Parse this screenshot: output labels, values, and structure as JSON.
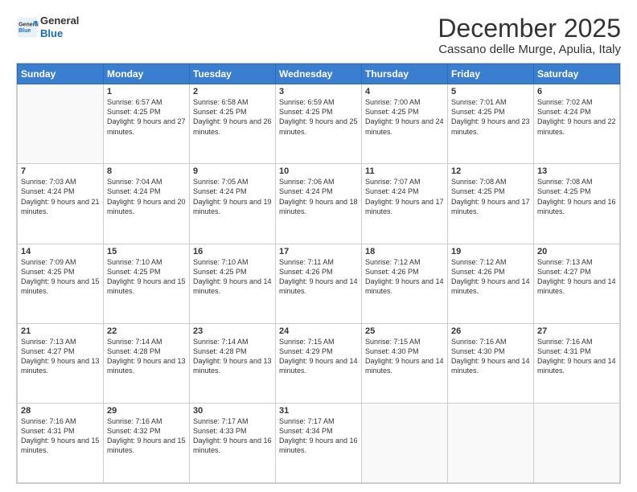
{
  "header": {
    "logo_line1": "General",
    "logo_line2": "Blue",
    "month": "December 2025",
    "location": "Cassano delle Murge, Apulia, Italy"
  },
  "weekdays": [
    "Sunday",
    "Monday",
    "Tuesday",
    "Wednesday",
    "Thursday",
    "Friday",
    "Saturday"
  ],
  "weeks": [
    [
      {
        "day": "",
        "sunrise": "",
        "sunset": "",
        "daylight": ""
      },
      {
        "day": "1",
        "sunrise": "6:57 AM",
        "sunset": "4:25 PM",
        "daylight": "9 hours and 27 minutes."
      },
      {
        "day": "2",
        "sunrise": "6:58 AM",
        "sunset": "4:25 PM",
        "daylight": "9 hours and 26 minutes."
      },
      {
        "day": "3",
        "sunrise": "6:59 AM",
        "sunset": "4:25 PM",
        "daylight": "9 hours and 25 minutes."
      },
      {
        "day": "4",
        "sunrise": "7:00 AM",
        "sunset": "4:25 PM",
        "daylight": "9 hours and 24 minutes."
      },
      {
        "day": "5",
        "sunrise": "7:01 AM",
        "sunset": "4:25 PM",
        "daylight": "9 hours and 23 minutes."
      },
      {
        "day": "6",
        "sunrise": "7:02 AM",
        "sunset": "4:24 PM",
        "daylight": "9 hours and 22 minutes."
      }
    ],
    [
      {
        "day": "7",
        "sunrise": "7:03 AM",
        "sunset": "4:24 PM",
        "daylight": "9 hours and 21 minutes."
      },
      {
        "day": "8",
        "sunrise": "7:04 AM",
        "sunset": "4:24 PM",
        "daylight": "9 hours and 20 minutes."
      },
      {
        "day": "9",
        "sunrise": "7:05 AM",
        "sunset": "4:24 PM",
        "daylight": "9 hours and 19 minutes."
      },
      {
        "day": "10",
        "sunrise": "7:06 AM",
        "sunset": "4:24 PM",
        "daylight": "9 hours and 18 minutes."
      },
      {
        "day": "11",
        "sunrise": "7:07 AM",
        "sunset": "4:24 PM",
        "daylight": "9 hours and 17 minutes."
      },
      {
        "day": "12",
        "sunrise": "7:08 AM",
        "sunset": "4:25 PM",
        "daylight": "9 hours and 17 minutes."
      },
      {
        "day": "13",
        "sunrise": "7:08 AM",
        "sunset": "4:25 PM",
        "daylight": "9 hours and 16 minutes."
      }
    ],
    [
      {
        "day": "14",
        "sunrise": "7:09 AM",
        "sunset": "4:25 PM",
        "daylight": "9 hours and 15 minutes."
      },
      {
        "day": "15",
        "sunrise": "7:10 AM",
        "sunset": "4:25 PM",
        "daylight": "9 hours and 15 minutes."
      },
      {
        "day": "16",
        "sunrise": "7:10 AM",
        "sunset": "4:25 PM",
        "daylight": "9 hours and 14 minutes."
      },
      {
        "day": "17",
        "sunrise": "7:11 AM",
        "sunset": "4:26 PM",
        "daylight": "9 hours and 14 minutes."
      },
      {
        "day": "18",
        "sunrise": "7:12 AM",
        "sunset": "4:26 PM",
        "daylight": "9 hours and 14 minutes."
      },
      {
        "day": "19",
        "sunrise": "7:12 AM",
        "sunset": "4:26 PM",
        "daylight": "9 hours and 14 minutes."
      },
      {
        "day": "20",
        "sunrise": "7:13 AM",
        "sunset": "4:27 PM",
        "daylight": "9 hours and 14 minutes."
      }
    ],
    [
      {
        "day": "21",
        "sunrise": "7:13 AM",
        "sunset": "4:27 PM",
        "daylight": "9 hours and 13 minutes."
      },
      {
        "day": "22",
        "sunrise": "7:14 AM",
        "sunset": "4:28 PM",
        "daylight": "9 hours and 13 minutes."
      },
      {
        "day": "23",
        "sunrise": "7:14 AM",
        "sunset": "4:28 PM",
        "daylight": "9 hours and 13 minutes."
      },
      {
        "day": "24",
        "sunrise": "7:15 AM",
        "sunset": "4:29 PM",
        "daylight": "9 hours and 14 minutes."
      },
      {
        "day": "25",
        "sunrise": "7:15 AM",
        "sunset": "4:30 PM",
        "daylight": "9 hours and 14 minutes."
      },
      {
        "day": "26",
        "sunrise": "7:16 AM",
        "sunset": "4:30 PM",
        "daylight": "9 hours and 14 minutes."
      },
      {
        "day": "27",
        "sunrise": "7:16 AM",
        "sunset": "4:31 PM",
        "daylight": "9 hours and 14 minutes."
      }
    ],
    [
      {
        "day": "28",
        "sunrise": "7:16 AM",
        "sunset": "4:31 PM",
        "daylight": "9 hours and 15 minutes."
      },
      {
        "day": "29",
        "sunrise": "7:16 AM",
        "sunset": "4:32 PM",
        "daylight": "9 hours and 15 minutes."
      },
      {
        "day": "30",
        "sunrise": "7:17 AM",
        "sunset": "4:33 PM",
        "daylight": "9 hours and 16 minutes."
      },
      {
        "day": "31",
        "sunrise": "7:17 AM",
        "sunset": "4:34 PM",
        "daylight": "9 hours and 16 minutes."
      },
      {
        "day": "",
        "sunrise": "",
        "sunset": "",
        "daylight": ""
      },
      {
        "day": "",
        "sunrise": "",
        "sunset": "",
        "daylight": ""
      },
      {
        "day": "",
        "sunrise": "",
        "sunset": "",
        "daylight": ""
      }
    ]
  ],
  "labels": {
    "sunrise_prefix": "Sunrise: ",
    "sunset_prefix": "Sunset: ",
    "daylight_prefix": "Daylight: "
  }
}
